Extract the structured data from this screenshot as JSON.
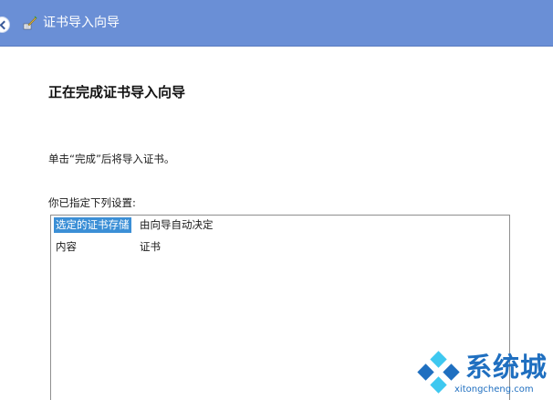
{
  "window": {
    "title": "证书导入向导"
  },
  "wizard": {
    "heading": "正在完成证书导入向导",
    "instruction": "单击“完成”后将导入证书。",
    "settings_label": "你已指定下列设置:",
    "settings": [
      {
        "key": "选定的证书存储",
        "value": "由向导自动决定",
        "selected": true
      },
      {
        "key": "内容",
        "value": "证书",
        "selected": false
      }
    ]
  },
  "watermark": {
    "brand": "系统城",
    "url": "xitongcheng.com"
  },
  "icons": {
    "back": "back-arrow-icon",
    "wizard": "certificate-wizard-icon",
    "logo": "xitongcheng-logo-icon"
  },
  "colors": {
    "titlebar": "#6a8fd6",
    "selection": "#3b8fd6",
    "watermark": "#1f6fc0"
  }
}
